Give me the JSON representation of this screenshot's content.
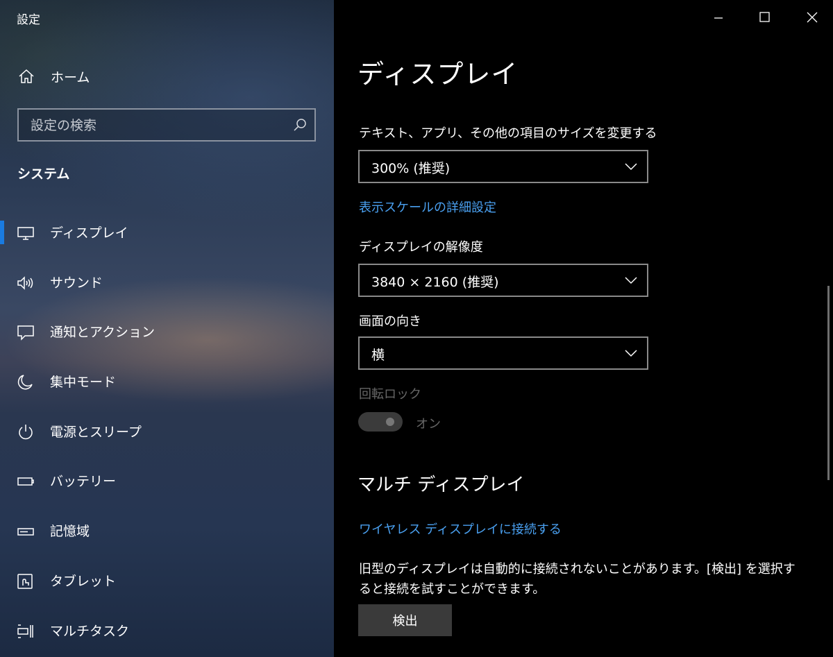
{
  "window": {
    "title": "設定"
  },
  "sidebar": {
    "home_label": "ホーム",
    "search_placeholder": "設定の検索",
    "section_title": "システム",
    "items": [
      {
        "label": "ディスプレイ",
        "icon": "monitor-icon",
        "active": true
      },
      {
        "label": "サウンド",
        "icon": "speaker-icon",
        "active": false
      },
      {
        "label": "通知とアクション",
        "icon": "message-icon",
        "active": false
      },
      {
        "label": "集中モード",
        "icon": "moon-icon",
        "active": false
      },
      {
        "label": "電源とスリープ",
        "icon": "power-icon",
        "active": false
      },
      {
        "label": "バッテリー",
        "icon": "battery-icon",
        "active": false
      },
      {
        "label": "記憶域",
        "icon": "storage-icon",
        "active": false
      },
      {
        "label": "タブレット",
        "icon": "tablet-icon",
        "active": false
      },
      {
        "label": "マルチタスク",
        "icon": "multitask-icon",
        "active": false
      }
    ]
  },
  "main": {
    "title": "ディスプレイ",
    "scale_label": "テキスト、アプリ、その他の項目のサイズを変更する",
    "scale_value": "300% (推奨)",
    "advanced_scale_link": "表示スケールの詳細設定",
    "resolution_label": "ディスプレイの解像度",
    "resolution_value": "3840 × 2160 (推奨)",
    "orientation_label": "画面の向き",
    "orientation_value": "横",
    "rotation_lock_label": "回転ロック",
    "rotation_lock_state": "オン",
    "multi_display_title": "マルチ ディスプレイ",
    "wireless_link": "ワイヤレス ディスプレイに接続する",
    "detect_description": "旧型のディスプレイは自動的に接続されないことがあります。[検出] を選択すると接続を試すことができます。",
    "detect_button": "検出"
  },
  "colors": {
    "accent": "#1a7be0",
    "link": "#4aa0f0",
    "background": "#000000"
  }
}
